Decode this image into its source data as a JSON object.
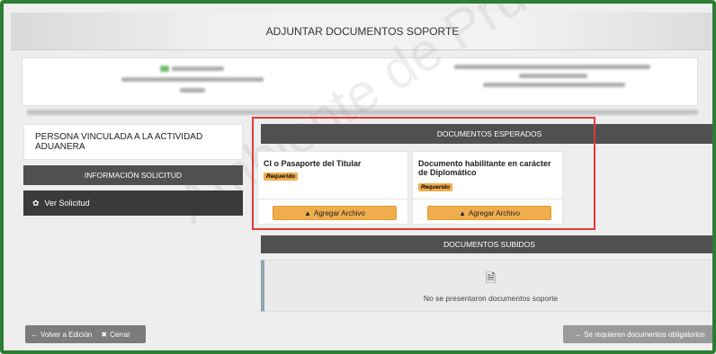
{
  "header": {
    "title": "ADJUNTAR DOCUMENTOS SOPORTE"
  },
  "watermark": {
    "text": "Ambiente de Pruebas"
  },
  "left_panel": {
    "person_label": "PERSONA VINCULADA A LA ACTIVIDAD ADUANERA",
    "info_solicitud_label": "INFORMACIÓN SOLICITUD",
    "ver_solicitud_label": "Ver Solicitud"
  },
  "expected_docs": {
    "header": "DOCUMENTOS ESPERADOS",
    "items": [
      {
        "title": "CI o Pasaporte del Titular",
        "badge": "Requerido",
        "button": "Agregar Archivo"
      },
      {
        "title": "Documento habilitante en carácter de Diplomático",
        "badge": "Requerido",
        "button": "Agregar Archivo"
      }
    ]
  },
  "uploaded_docs": {
    "header": "DOCUMENTOS SUBIDOS",
    "empty_message": "No se presentaron documentos soporte"
  },
  "footer": {
    "back_label": "Volver a Edición",
    "close_label": "Cerrar",
    "required_label": "Se requieren documentos obligatorios"
  },
  "colors": {
    "accent_warning": "#f0ad4e",
    "dark_bar": "#505050",
    "highlight_border": "#e53935",
    "frame_border": "#2e7d32"
  }
}
